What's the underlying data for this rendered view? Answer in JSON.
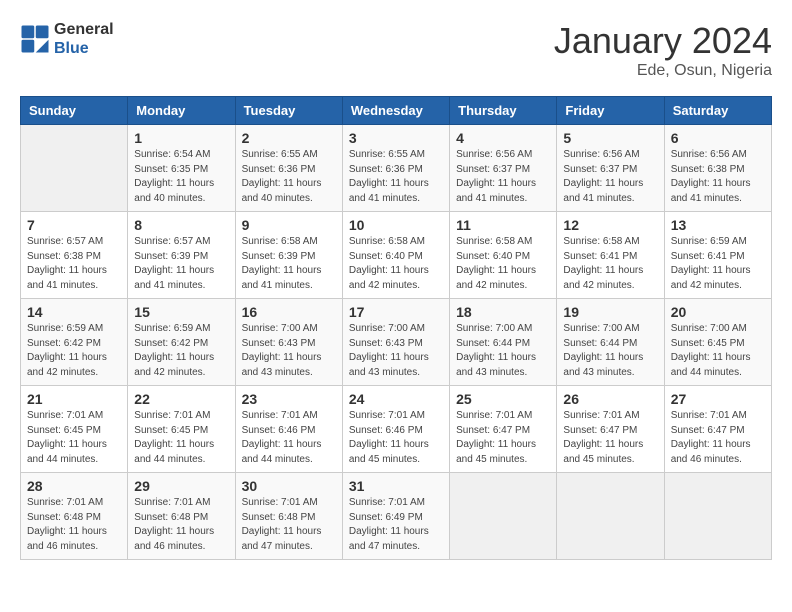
{
  "logo": {
    "line1": "General",
    "line2": "Blue"
  },
  "title": "January 2024",
  "subtitle": "Ede, Osun, Nigeria",
  "days_of_week": [
    "Sunday",
    "Monday",
    "Tuesday",
    "Wednesday",
    "Thursday",
    "Friday",
    "Saturday"
  ],
  "weeks": [
    [
      {
        "num": "",
        "info": ""
      },
      {
        "num": "1",
        "info": "Sunrise: 6:54 AM\nSunset: 6:35 PM\nDaylight: 11 hours\nand 40 minutes."
      },
      {
        "num": "2",
        "info": "Sunrise: 6:55 AM\nSunset: 6:36 PM\nDaylight: 11 hours\nand 40 minutes."
      },
      {
        "num": "3",
        "info": "Sunrise: 6:55 AM\nSunset: 6:36 PM\nDaylight: 11 hours\nand 41 minutes."
      },
      {
        "num": "4",
        "info": "Sunrise: 6:56 AM\nSunset: 6:37 PM\nDaylight: 11 hours\nand 41 minutes."
      },
      {
        "num": "5",
        "info": "Sunrise: 6:56 AM\nSunset: 6:37 PM\nDaylight: 11 hours\nand 41 minutes."
      },
      {
        "num": "6",
        "info": "Sunrise: 6:56 AM\nSunset: 6:38 PM\nDaylight: 11 hours\nand 41 minutes."
      }
    ],
    [
      {
        "num": "7",
        "info": "Sunrise: 6:57 AM\nSunset: 6:38 PM\nDaylight: 11 hours\nand 41 minutes."
      },
      {
        "num": "8",
        "info": "Sunrise: 6:57 AM\nSunset: 6:39 PM\nDaylight: 11 hours\nand 41 minutes."
      },
      {
        "num": "9",
        "info": "Sunrise: 6:58 AM\nSunset: 6:39 PM\nDaylight: 11 hours\nand 41 minutes."
      },
      {
        "num": "10",
        "info": "Sunrise: 6:58 AM\nSunset: 6:40 PM\nDaylight: 11 hours\nand 42 minutes."
      },
      {
        "num": "11",
        "info": "Sunrise: 6:58 AM\nSunset: 6:40 PM\nDaylight: 11 hours\nand 42 minutes."
      },
      {
        "num": "12",
        "info": "Sunrise: 6:58 AM\nSunset: 6:41 PM\nDaylight: 11 hours\nand 42 minutes."
      },
      {
        "num": "13",
        "info": "Sunrise: 6:59 AM\nSunset: 6:41 PM\nDaylight: 11 hours\nand 42 minutes."
      }
    ],
    [
      {
        "num": "14",
        "info": "Sunrise: 6:59 AM\nSunset: 6:42 PM\nDaylight: 11 hours\nand 42 minutes."
      },
      {
        "num": "15",
        "info": "Sunrise: 6:59 AM\nSunset: 6:42 PM\nDaylight: 11 hours\nand 42 minutes."
      },
      {
        "num": "16",
        "info": "Sunrise: 7:00 AM\nSunset: 6:43 PM\nDaylight: 11 hours\nand 43 minutes."
      },
      {
        "num": "17",
        "info": "Sunrise: 7:00 AM\nSunset: 6:43 PM\nDaylight: 11 hours\nand 43 minutes."
      },
      {
        "num": "18",
        "info": "Sunrise: 7:00 AM\nSunset: 6:44 PM\nDaylight: 11 hours\nand 43 minutes."
      },
      {
        "num": "19",
        "info": "Sunrise: 7:00 AM\nSunset: 6:44 PM\nDaylight: 11 hours\nand 43 minutes."
      },
      {
        "num": "20",
        "info": "Sunrise: 7:00 AM\nSunset: 6:45 PM\nDaylight: 11 hours\nand 44 minutes."
      }
    ],
    [
      {
        "num": "21",
        "info": "Sunrise: 7:01 AM\nSunset: 6:45 PM\nDaylight: 11 hours\nand 44 minutes."
      },
      {
        "num": "22",
        "info": "Sunrise: 7:01 AM\nSunset: 6:45 PM\nDaylight: 11 hours\nand 44 minutes."
      },
      {
        "num": "23",
        "info": "Sunrise: 7:01 AM\nSunset: 6:46 PM\nDaylight: 11 hours\nand 44 minutes."
      },
      {
        "num": "24",
        "info": "Sunrise: 7:01 AM\nSunset: 6:46 PM\nDaylight: 11 hours\nand 45 minutes."
      },
      {
        "num": "25",
        "info": "Sunrise: 7:01 AM\nSunset: 6:47 PM\nDaylight: 11 hours\nand 45 minutes."
      },
      {
        "num": "26",
        "info": "Sunrise: 7:01 AM\nSunset: 6:47 PM\nDaylight: 11 hours\nand 45 minutes."
      },
      {
        "num": "27",
        "info": "Sunrise: 7:01 AM\nSunset: 6:47 PM\nDaylight: 11 hours\nand 46 minutes."
      }
    ],
    [
      {
        "num": "28",
        "info": "Sunrise: 7:01 AM\nSunset: 6:48 PM\nDaylight: 11 hours\nand 46 minutes."
      },
      {
        "num": "29",
        "info": "Sunrise: 7:01 AM\nSunset: 6:48 PM\nDaylight: 11 hours\nand 46 minutes."
      },
      {
        "num": "30",
        "info": "Sunrise: 7:01 AM\nSunset: 6:48 PM\nDaylight: 11 hours\nand 47 minutes."
      },
      {
        "num": "31",
        "info": "Sunrise: 7:01 AM\nSunset: 6:49 PM\nDaylight: 11 hours\nand 47 minutes."
      },
      {
        "num": "",
        "info": ""
      },
      {
        "num": "",
        "info": ""
      },
      {
        "num": "",
        "info": ""
      }
    ]
  ]
}
